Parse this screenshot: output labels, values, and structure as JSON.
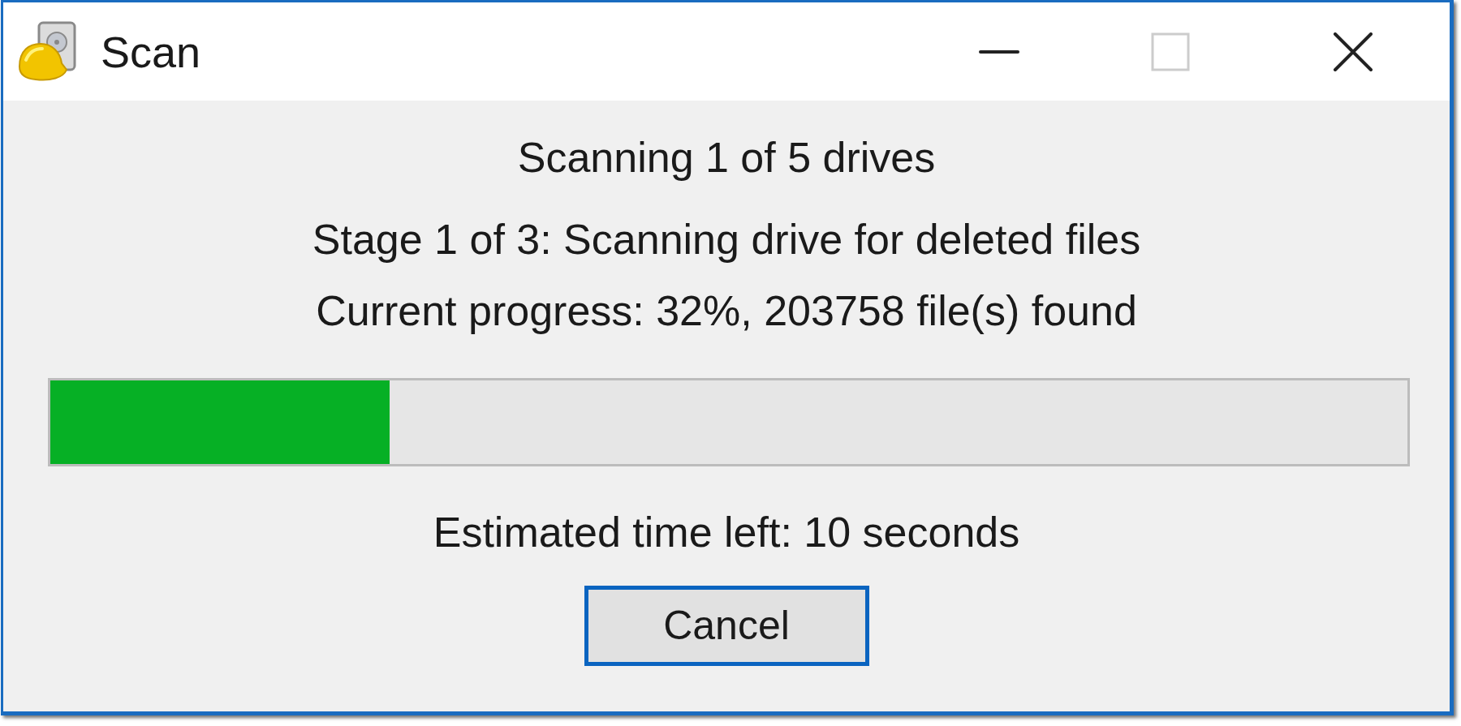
{
  "window": {
    "title": "Scan"
  },
  "status_lines": [
    "Scanning 1 of 5 drives",
    "Stage 1 of 3: Scanning drive for deleted files",
    "Current progress: 32%, 203758 file(s) found"
  ],
  "progress_bar": {
    "level": 0.25
  },
  "time_left": "Estimated time left: 10 seconds",
  "buttons": [
    {
      "label": "Cancel",
      "focused": true
    }
  ]
}
